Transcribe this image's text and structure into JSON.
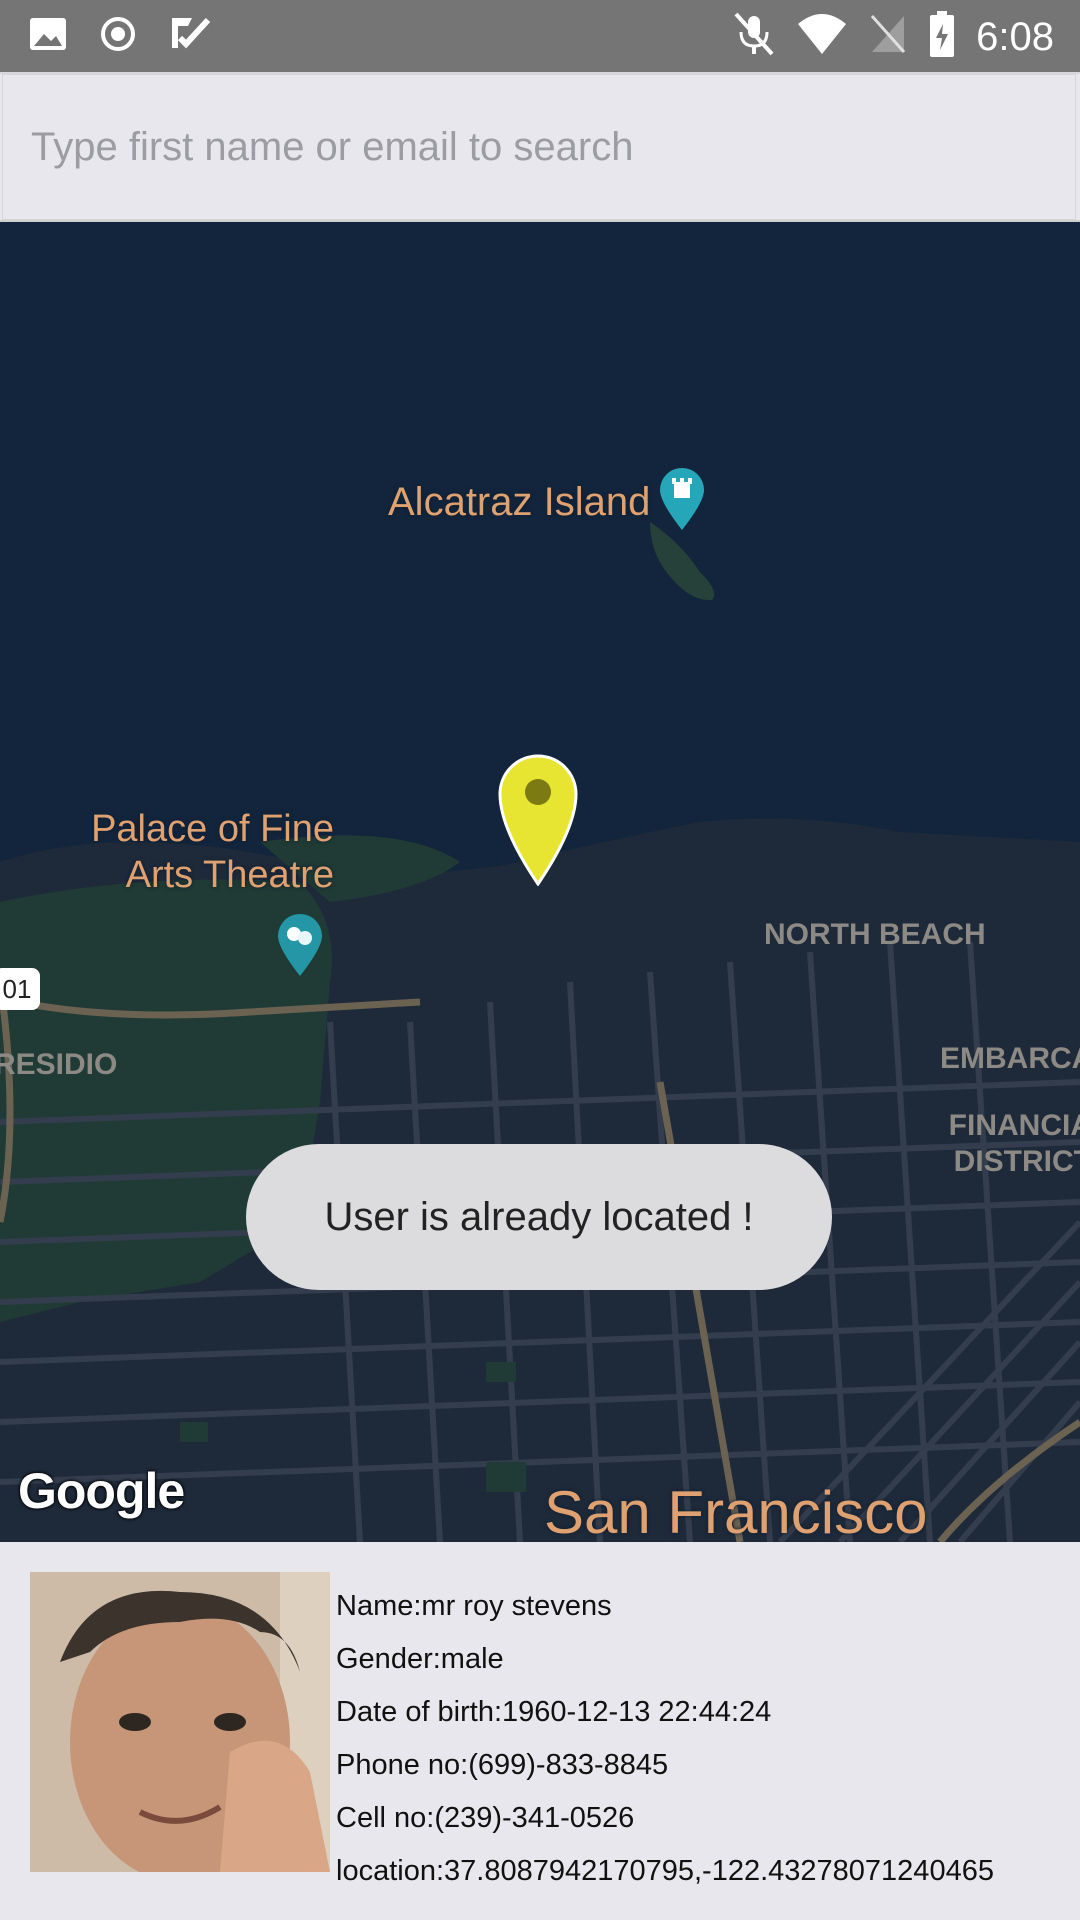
{
  "status_bar": {
    "time": "6:08",
    "left_icons": [
      "image-icon",
      "radio-button-icon",
      "play-store-icon"
    ],
    "right_icons": [
      "mic-muted-icon",
      "wifi-icon",
      "no-sim-icon",
      "battery-icon"
    ]
  },
  "search": {
    "placeholder": "Type first name or email to search",
    "value": ""
  },
  "map": {
    "labels": {
      "alcatraz": "Alcatraz Island",
      "palace_line1": "Palace of Fine",
      "palace_line2": "Arts Theatre",
      "north_beach": "NORTH BEACH",
      "presidio": "RESIDIO",
      "embarca": "EMBARCA",
      "financial_line1": "FINANCIA",
      "financial_line2": "DISTRICT",
      "san_francisco": "San Francisco",
      "route": "01"
    },
    "google_logo": "Google",
    "marker_color": "#e8e532",
    "poi_color": "#26a7b9"
  },
  "toast": {
    "message": "User is already located !"
  },
  "user": {
    "name": "Name:mr roy stevens",
    "gender": "Gender:male",
    "dob": "Date of birth:1960-12-13 22:44:24",
    "phone": "Phone no:(699)-833-8845",
    "cell": "Cell no:(239)-341-0526",
    "location": "location:37.8087942170795,-122.43278071240465"
  },
  "colors": {
    "status_bar": "#757575",
    "map_water": "#13253c",
    "map_land": "#1e2a3a",
    "label": "#e0a171"
  }
}
